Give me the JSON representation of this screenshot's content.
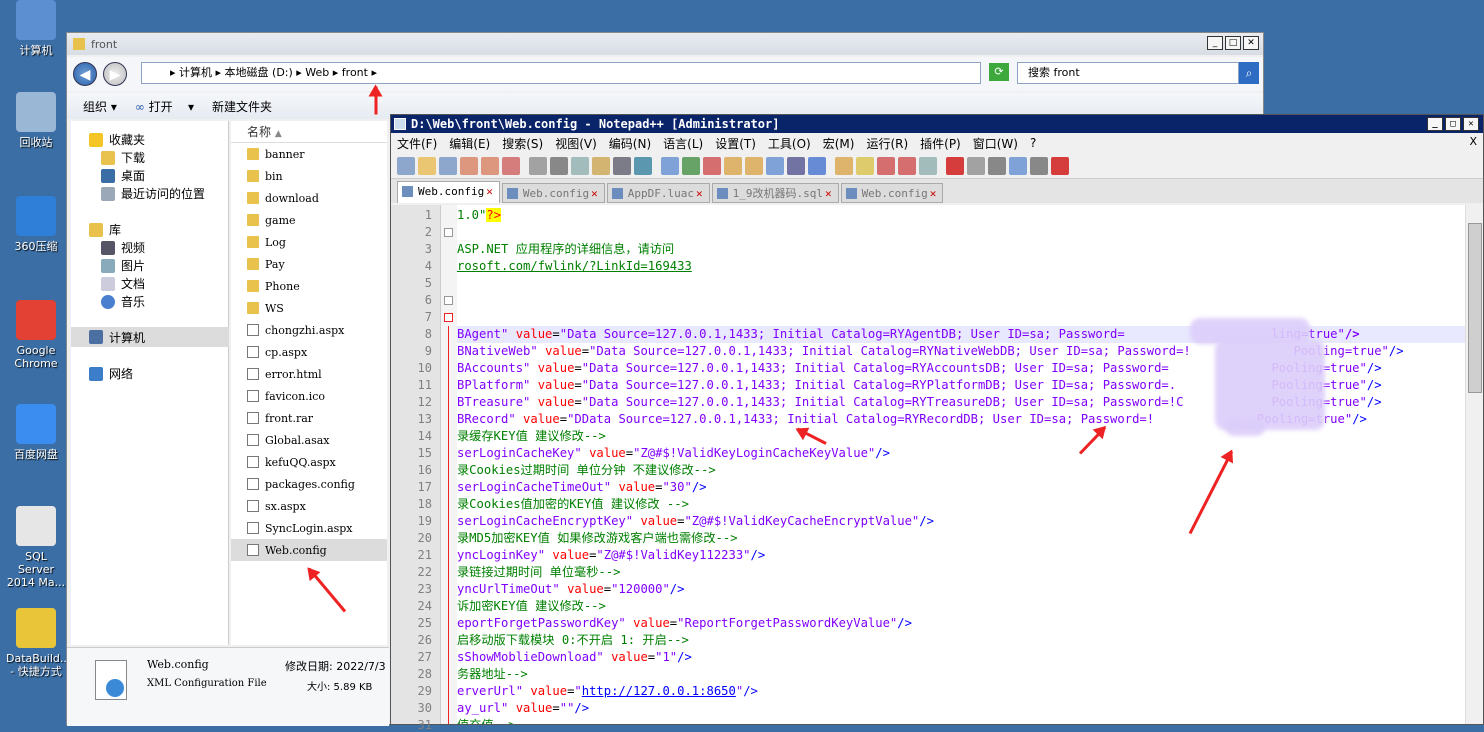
{
  "desktop": {
    "icons": [
      {
        "label": "计算机",
        "name": "computer-icon",
        "color": "#5b8fd1"
      },
      {
        "label": "回收站",
        "name": "recycle-bin-icon",
        "color": "#9bb7d6"
      },
      {
        "label": "360压缩",
        "name": "360-zip-icon",
        "color": "#2f7fd8"
      },
      {
        "label": "Google Chrome",
        "name": "chrome-icon",
        "color": "#e34133"
      },
      {
        "label": "百度网盘",
        "name": "baidu-netdisk-icon",
        "color": "#3b8df0"
      },
      {
        "label": "SQL Server 2014 Ma...",
        "name": "sql-server-icon",
        "color": "#e6e6e6"
      },
      {
        "label": "DataBuild... - 快捷方式",
        "name": "databuild-icon",
        "color": "#e9c53a"
      }
    ]
  },
  "explorer": {
    "title": "front",
    "address": "▸ 计算机 ▸ 本地磁盘 (D:) ▸ Web ▸ front ▸",
    "search_placeholder": "搜索 front",
    "toolbar": {
      "organize": "组织 ▾",
      "open": "打开",
      "open_arrow": "▾",
      "new_folder": "新建文件夹"
    },
    "nav": {
      "favorites": "收藏夹",
      "downloads": "下载",
      "desktop": "桌面",
      "recent": "最近访问的位置",
      "libraries": "库",
      "videos": "视频",
      "pictures": "图片",
      "documents": "文档",
      "music": "音乐",
      "computer": "计算机",
      "network": "网络"
    },
    "column_name": "名称",
    "files": [
      {
        "name": "banner",
        "type": "folder"
      },
      {
        "name": "bin",
        "type": "folder"
      },
      {
        "name": "download",
        "type": "folder"
      },
      {
        "name": "game",
        "type": "folder"
      },
      {
        "name": "Log",
        "type": "folder"
      },
      {
        "name": "Pay",
        "type": "folder"
      },
      {
        "name": "Phone",
        "type": "folder"
      },
      {
        "name": "WS",
        "type": "folder"
      },
      {
        "name": "chongzhi.aspx",
        "type": "file"
      },
      {
        "name": "cp.aspx",
        "type": "file"
      },
      {
        "name": "error.html",
        "type": "file"
      },
      {
        "name": "favicon.ico",
        "type": "file"
      },
      {
        "name": "front.rar",
        "type": "file"
      },
      {
        "name": "Global.asax",
        "type": "file"
      },
      {
        "name": "kefuQQ.aspx",
        "type": "file"
      },
      {
        "name": "packages.config",
        "type": "file"
      },
      {
        "name": "sx.aspx",
        "type": "file"
      },
      {
        "name": "SyncLogin.aspx",
        "type": "file"
      },
      {
        "name": "Web.config",
        "type": "file",
        "selected": true
      }
    ],
    "details": {
      "filename": "Web.config",
      "filetype": "XML Configuration File",
      "modified_label": "修改日期: 2022/7/3",
      "size_label": "大小: 5.89 KB"
    }
  },
  "npp": {
    "title": "D:\\Web\\front\\Web.config - Notepad++ [Administrator]",
    "menu": [
      "文件(F)",
      "编辑(E)",
      "搜索(S)",
      "视图(V)",
      "编码(N)",
      "语言(L)",
      "设置(T)",
      "工具(O)",
      "宏(M)",
      "运行(R)",
      "插件(P)",
      "窗口(W)",
      "?"
    ],
    "close_x": "X",
    "tabs": [
      "Web.config",
      "Web.config",
      "AppDF.luac",
      "1_9改机器码.sql",
      "Web.config"
    ],
    "lines": [
      {
        "n": "1",
        "segs": [
          [
            "g",
            "1.0\""
          ],
          [
            "pi",
            "?>"
          ]
        ]
      },
      {
        "n": "2",
        "segs": []
      },
      {
        "n": "3",
        "segs": [
          [
            "g",
            "ASP.NET 应用程序的详细信息，请访问"
          ]
        ]
      },
      {
        "n": "4",
        "segs": [
          [
            "g u",
            "rosoft.com/fwlink/?LinkId=169433"
          ]
        ]
      },
      {
        "n": "5",
        "segs": []
      },
      {
        "n": "6",
        "segs": []
      },
      {
        "n": "7",
        "segs": []
      },
      {
        "n": "8",
        "hl": true,
        "segs": [
          [
            "p",
            "BAgent\" "
          ],
          [
            "r",
            "value"
          ],
          [
            "k",
            "="
          ],
          [
            "p",
            "\"Data Source=127.0.0.1,1433; Initial Catalog=RYAgentDB; User ID=sa; Password=                    ling=true\""
          ],
          [
            "pu",
            "/>"
          ]
        ]
      },
      {
        "n": "9",
        "segs": [
          [
            "p",
            "BNativeWeb\" "
          ],
          [
            "r",
            "value"
          ],
          [
            "k",
            "="
          ],
          [
            "p",
            "\"Data Source=127.0.0.1,1433; Initial Catalog=RYNativeWebDB; User ID=sa; Password=!              Pooling=true\""
          ],
          [
            "b",
            "/>"
          ]
        ]
      },
      {
        "n": "10",
        "segs": [
          [
            "p",
            "BAccounts\" "
          ],
          [
            "r",
            "value"
          ],
          [
            "k",
            "="
          ],
          [
            "p",
            "\"Data Source=127.0.0.1,1433; Initial Catalog=RYAccountsDB; User ID=sa; Password=              Pooling=true\""
          ],
          [
            "b",
            "/>"
          ]
        ]
      },
      {
        "n": "11",
        "segs": [
          [
            "p",
            "BPlatform\" "
          ],
          [
            "r",
            "value"
          ],
          [
            "k",
            "="
          ],
          [
            "p",
            "\"Data Source=127.0.0.1,1433; Initial Catalog=RYPlatformDB; User ID=sa; Password=.             Pooling=true\""
          ],
          [
            "b",
            "/>"
          ]
        ]
      },
      {
        "n": "12",
        "segs": [
          [
            "p",
            "BTreasure\" "
          ],
          [
            "r",
            "value"
          ],
          [
            "k",
            "="
          ],
          [
            "p",
            "\"Data Source=127.0.0.1,1433; Initial Catalog=RYTreasureDB; User ID=sa; Password=!C            Pooling=true\""
          ],
          [
            "b",
            "/>"
          ]
        ]
      },
      {
        "n": "13",
        "segs": [
          [
            "p",
            "BRecord\" "
          ],
          [
            "r",
            "value"
          ],
          [
            "k",
            "="
          ],
          [
            "p",
            "\"DData Source=127.0.0.1,1433; Initial Catalog=RYRecordDB; User ID=sa; Password=!              Pooling=true\""
          ],
          [
            "b",
            "/>"
          ]
        ]
      },
      {
        "n": "14",
        "segs": [
          [
            "g",
            "录缓存KEY值 建议修改-->"
          ]
        ]
      },
      {
        "n": "15",
        "segs": [
          [
            "p",
            "serLoginCacheKey\" "
          ],
          [
            "r",
            "value"
          ],
          [
            "k",
            "="
          ],
          [
            "p",
            "\"Z@#$!ValidKeyLoginCacheKeyValue\""
          ],
          [
            "b",
            "/>"
          ]
        ]
      },
      {
        "n": "16",
        "segs": [
          [
            "g",
            "录Cookies过期时间 单位分钟 不建议修改-->"
          ]
        ]
      },
      {
        "n": "17",
        "segs": [
          [
            "p",
            "serLoginCacheTimeOut\" "
          ],
          [
            "r",
            "value"
          ],
          [
            "k",
            "="
          ],
          [
            "p",
            "\"30\""
          ],
          [
            "b",
            "/>"
          ]
        ]
      },
      {
        "n": "18",
        "segs": [
          [
            "g",
            "录Cookies值加密的KEY值 建议修改 -->"
          ]
        ]
      },
      {
        "n": "19",
        "segs": [
          [
            "p",
            "serLoginCacheEncryptKey\" "
          ],
          [
            "r",
            "value"
          ],
          [
            "k",
            "="
          ],
          [
            "p",
            "\"Z@#$!ValidKeyCacheEncryptValue\""
          ],
          [
            "b",
            "/>"
          ]
        ]
      },
      {
        "n": "20",
        "segs": [
          [
            "g",
            "录MD5加密KEY值 如果修改游戏客户端也需修改-->"
          ]
        ]
      },
      {
        "n": "21",
        "segs": [
          [
            "p",
            "yncLoginKey\" "
          ],
          [
            "r",
            "value"
          ],
          [
            "k",
            "="
          ],
          [
            "p",
            "\"Z@#$!ValidKey112233\""
          ],
          [
            "b",
            "/>"
          ]
        ]
      },
      {
        "n": "22",
        "segs": [
          [
            "g",
            "录链接过期时间 单位毫秒-->"
          ]
        ]
      },
      {
        "n": "23",
        "segs": [
          [
            "p",
            "yncUrlTimeOut\" "
          ],
          [
            "r",
            "value"
          ],
          [
            "k",
            "="
          ],
          [
            "p",
            "\"120000\""
          ],
          [
            "b",
            "/>"
          ]
        ]
      },
      {
        "n": "24",
        "segs": [
          [
            "g",
            "诉加密KEY值 建议修改-->"
          ]
        ]
      },
      {
        "n": "25",
        "segs": [
          [
            "p",
            "eportForgetPasswordKey\" "
          ],
          [
            "r",
            "value"
          ],
          [
            "k",
            "="
          ],
          [
            "p",
            "\"ReportForgetPasswordKeyValue\""
          ],
          [
            "b",
            "/>"
          ]
        ]
      },
      {
        "n": "26",
        "segs": [
          [
            "g",
            "启移动版下载模块 0:不开启 1: 开启-->"
          ]
        ]
      },
      {
        "n": "27",
        "segs": [
          [
            "p",
            "sShowMoblieDownload\" "
          ],
          [
            "r",
            "value"
          ],
          [
            "k",
            "="
          ],
          [
            "p",
            "\"1\""
          ],
          [
            "b",
            "/>"
          ]
        ]
      },
      {
        "n": "28",
        "segs": [
          [
            "g",
            "务器地址-->"
          ]
        ]
      },
      {
        "n": "29",
        "segs": [
          [
            "p",
            "erverUrl\" "
          ],
          [
            "r",
            "value"
          ],
          [
            "k",
            "="
          ],
          [
            "p",
            "\""
          ],
          [
            "b u",
            "http://127.0.0.1:8650"
          ],
          [
            "p",
            "\""
          ],
          [
            "b",
            "/>"
          ]
        ]
      },
      {
        "n": "30",
        "segs": [
          [
            "p",
            "ay_url\" "
          ],
          [
            "r",
            "value"
          ],
          [
            "k",
            "="
          ],
          [
            "p",
            "\"\""
          ],
          [
            "b",
            "/>"
          ]
        ]
      },
      {
        "n": "31",
        "segs": [
          [
            "g",
            "值充值-->"
          ]
        ]
      }
    ]
  }
}
